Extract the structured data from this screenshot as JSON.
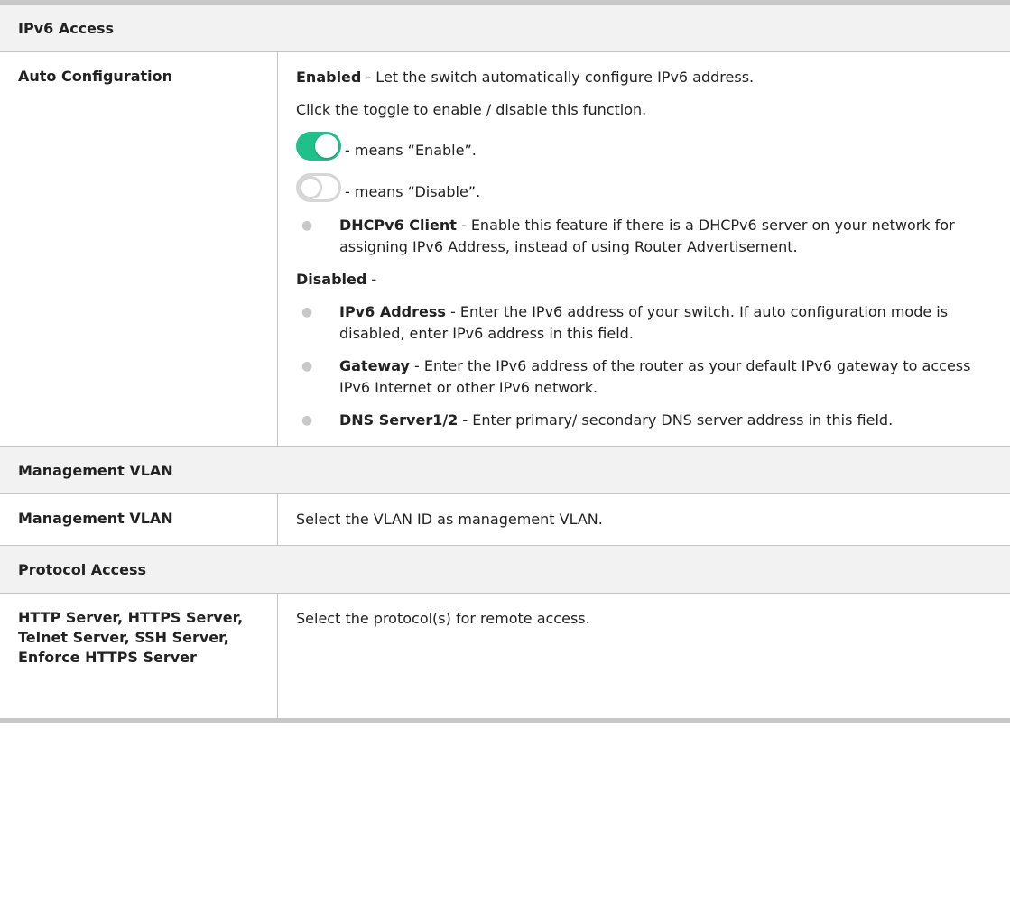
{
  "ipv6": {
    "section_title": "IPv6 Access",
    "auto_label": "Auto Configuration",
    "enabled_term": "Enabled",
    "enabled_desc": " - Let the switch automatically configure IPv6 address.",
    "toggle_hint": "Click the toggle to enable / disable this function.",
    "toggle_on_text": "- means “Enable”.",
    "toggle_off_text": "- means “Disable”.",
    "accent_color": "#20c08a",
    "dhcp_term": "DHCPv6 Client",
    "dhcp_desc": " - Enable this feature if there is a DHCPv6 server on your network for assigning IPv6 Address, instead of using Router Advertisement.",
    "disabled_term": "Disabled",
    "disabled_desc": " -",
    "addr_term": "IPv6 Address",
    "addr_desc": " - Enter the IPv6 address of your switch. If auto configuration mode is disabled, enter IPv6 address in this field.",
    "gw_term": "Gateway",
    "gw_desc": " - Enter the IPv6 address of the router as your default IPv6 gateway to access IPv6 Internet or other IPv6 network.",
    "dns_term": "DNS Server1/2",
    "dns_desc": " - Enter primary/ secondary DNS server address in this field."
  },
  "mgmt": {
    "section_title": "Management VLAN",
    "label": "Management VLAN",
    "desc": "Select the VLAN ID as management VLAN."
  },
  "protocol": {
    "section_title": "Protocol Access",
    "label": "HTTP Server, HTTPS Server, Telnet Server, SSH Server, Enforce HTTPS Server",
    "desc": "Select the protocol(s) for remote access."
  }
}
